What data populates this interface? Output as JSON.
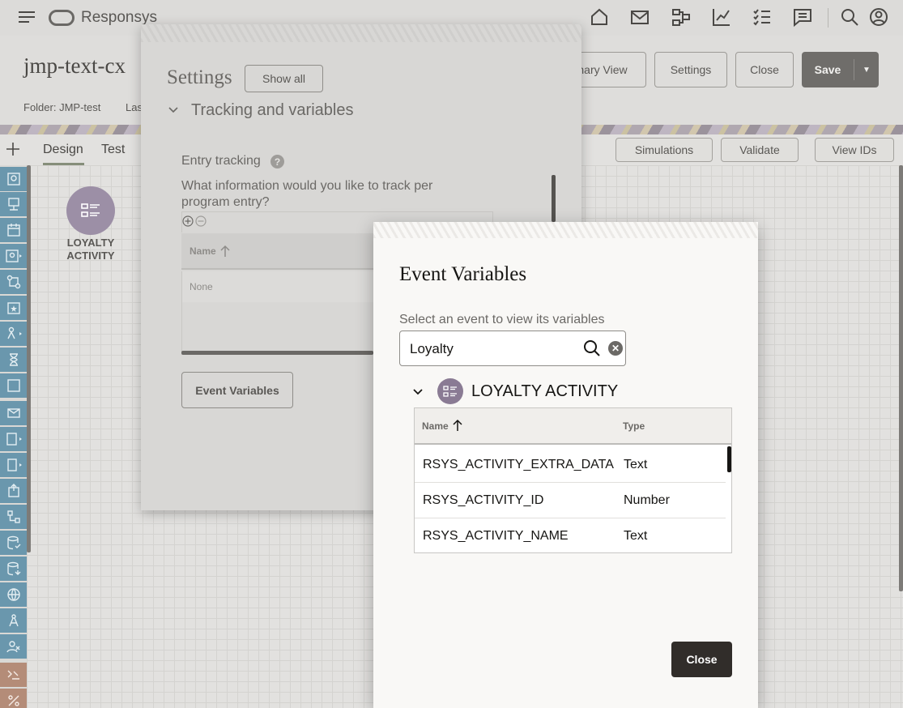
{
  "app": {
    "brand": "Responsys"
  },
  "topbar": {
    "icons": [
      "menu-icon",
      "home-icon",
      "mail-icon",
      "program-icon",
      "chart-icon",
      "checklist-icon",
      "chat-icon",
      "search-icon",
      "user-icon"
    ]
  },
  "header": {
    "title": "jmp-text-cx",
    "folder": "Folder: JMP-test",
    "last_modified": "Las",
    "buttons": {
      "summary_view": "nary View",
      "settings": "Settings",
      "close": "Close",
      "save": "Save"
    }
  },
  "toolbar": {
    "tabs": {
      "design": "Design",
      "test": "Test"
    },
    "buttons": {
      "simulations": "Simulations",
      "validate": "Validate",
      "view_ids": "View IDs"
    }
  },
  "canvas": {
    "node_label": "LOYALTY ACTIVITY"
  },
  "settings": {
    "title": "Settings",
    "show_all": "Show all",
    "section": "Tracking and variables",
    "entry_tracking": "Entry tracking",
    "question": "What information would you like to track per program entry?",
    "table": {
      "col_name": "Name",
      "empty": "None"
    },
    "event_variables_button": "Event Variables"
  },
  "dialog": {
    "title": "Event Variables",
    "subtitle": "Select an event to view its variables",
    "search_value": "Loyalty",
    "event_name": "LOYALTY ACTIVITY",
    "columns": {
      "name": "Name",
      "type": "Type"
    },
    "rows": [
      {
        "name": "RSYS_ACTIVITY_EXTRA_DATA",
        "type": "Text"
      },
      {
        "name": "RSYS_ACTIVITY_ID",
        "type": "Number"
      },
      {
        "name": "RSYS_ACTIVITY_NAME",
        "type": "Text"
      }
    ],
    "close_button": "Close"
  },
  "colors": {
    "palette_blue": "#6a97ad",
    "palette_purple": "#8e7a99",
    "palette_clay": "#b48c78",
    "node_purple": "#9c8fa6",
    "dark_button": "#312d2a"
  }
}
